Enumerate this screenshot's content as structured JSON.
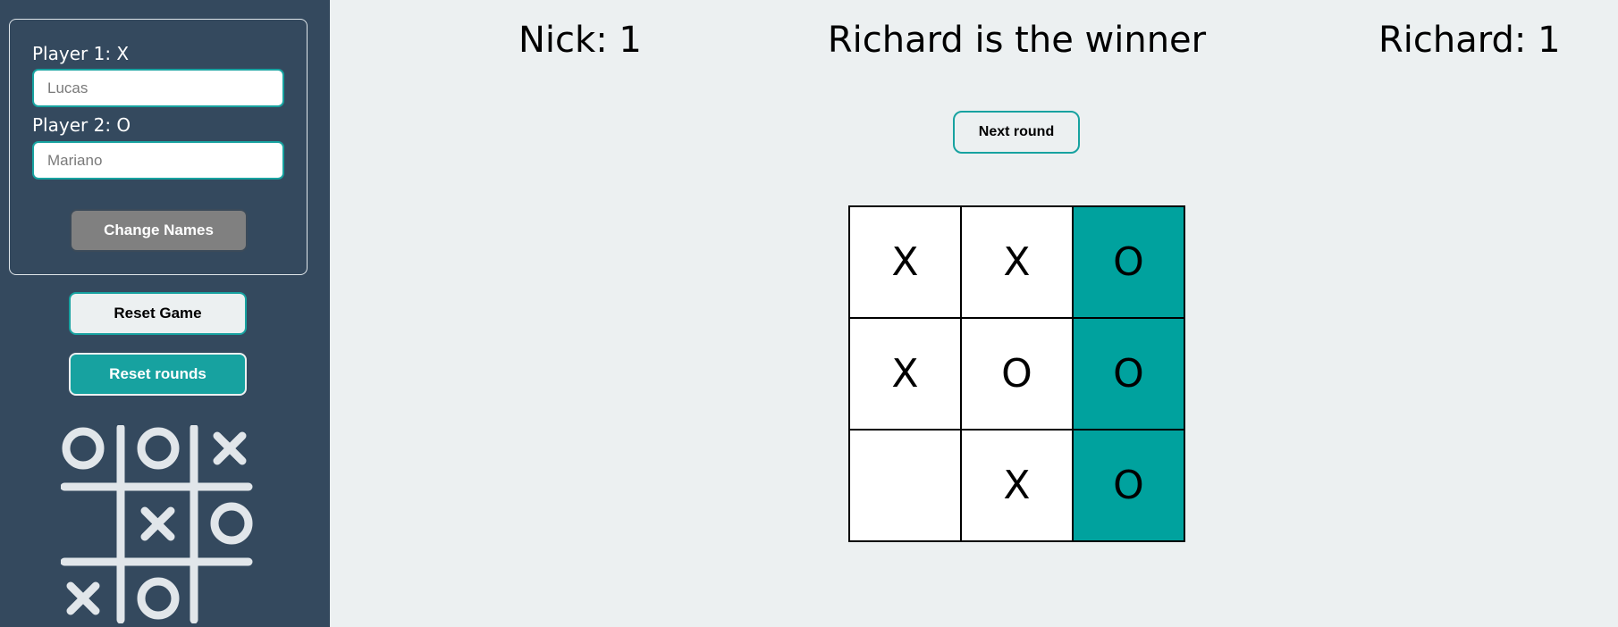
{
  "sidebar": {
    "player1_label": "Player 1: X",
    "player1_placeholder": "Lucas",
    "player2_label": "Player 2: O",
    "player2_placeholder": "Mariano",
    "change_names_label": "Change Names",
    "reset_game_label": "Reset Game",
    "reset_rounds_label": "Reset rounds",
    "logo": "tic-tac-toe-logo"
  },
  "scoreboard": {
    "left": "Nick: 1",
    "status": "Richard is the winner",
    "right": "Richard: 1"
  },
  "next_round_label": "Next round",
  "board": {
    "cells": [
      "X",
      "X",
      "O",
      "X",
      "O",
      "O",
      "",
      "X",
      "O"
    ],
    "winning_cells": [
      2,
      5,
      8
    ],
    "win_color": "#00a29e"
  },
  "colors": {
    "sidebar_bg": "#34495e",
    "page_bg": "#ecf0f1",
    "accent": "#17a2a0"
  }
}
